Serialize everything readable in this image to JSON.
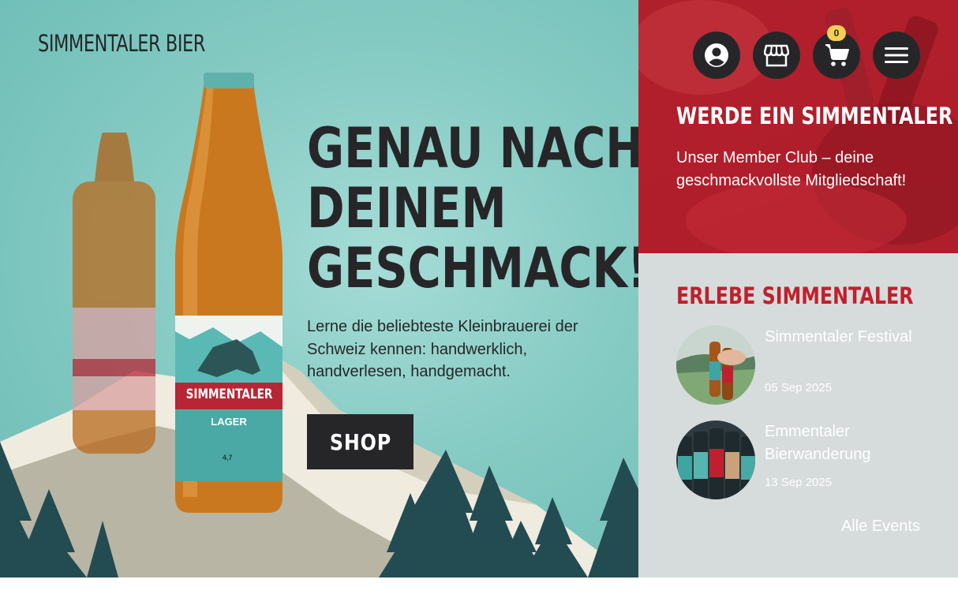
{
  "brand": {
    "name": "SIMMENTALER BIER"
  },
  "hero": {
    "headline_lines": [
      "GENAU NACH",
      "DEINEM",
      "GESCHMACK!?"
    ],
    "lead": "Lerne die beliebteste Kleinbrauerei der Schweiz kennen: handwerklich, handverlesen, handgemacht.",
    "shop_label": "SHOP",
    "bottle_label": {
      "brand": "SIMMENTALER",
      "variety": "LAGER",
      "abv": "4,7"
    }
  },
  "header_icons": {
    "account": "account-icon",
    "store": "store-icon",
    "cart": "cart-icon",
    "menu": "menu-icon",
    "cart_count": "0"
  },
  "member": {
    "title": "WERDE EIN SIMMENTALER",
    "text": "Unser Member Club – deine geschmackvollste Mitgliedschaft!"
  },
  "events": {
    "title": "ERLEBE SIMMENTALER",
    "items": [
      {
        "name": "Simmentaler Festival",
        "date": "05 Sep 2025"
      },
      {
        "name": "Emmentaler Bierwanderung",
        "date": "13 Sep 2025"
      }
    ],
    "all_label": "Alle Events"
  },
  "colors": {
    "dark": "#262629",
    "teal": "#86cbc4",
    "red": "#c0202d",
    "grey": "#d5dcdb",
    "badge": "#f5cf57"
  }
}
